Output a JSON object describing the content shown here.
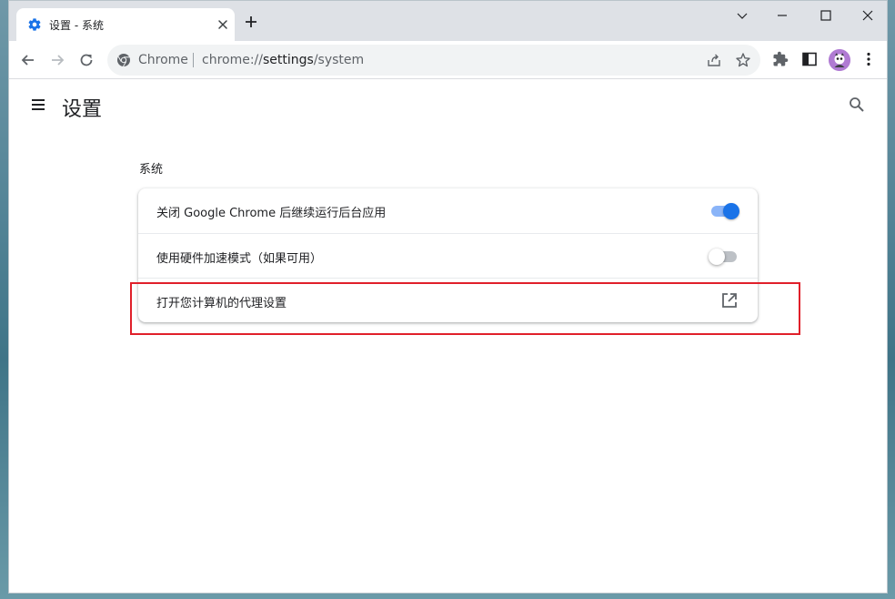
{
  "tab": {
    "title": "设置 - 系统",
    "icon": "gear-icon",
    "close_icon": "close-icon"
  },
  "new_tab_icon": "plus-icon",
  "window_controls": [
    "chevron-down-icon",
    "minimize-icon",
    "maximize-icon",
    "close-icon"
  ],
  "toolbar": {
    "back_icon": "back-arrow-icon",
    "forward_icon": "forward-arrow-icon",
    "reload_icon": "reload-icon",
    "omnibox": {
      "chip_label": "Chrome",
      "url_scheme": "chrome://",
      "url_host": "settings",
      "url_path": "/system",
      "share_icon": "share-icon",
      "bookmark_icon": "star-icon"
    },
    "extensions_icon": "puzzle-icon",
    "side_panel_icon": "side-panel-icon",
    "profile_icon": "avatar",
    "menu_icon": "kebab-menu-icon"
  },
  "settings": {
    "title": "设置",
    "section_title": "系统",
    "rows": [
      {
        "label": "关闭 Google Chrome 后继续运行后台应用",
        "control": "toggle",
        "checked": true
      },
      {
        "label": "使用硬件加速模式（如果可用）",
        "control": "toggle",
        "checked": false
      },
      {
        "label": "打开您计算机的代理设置",
        "control": "external-link",
        "icon": "open-in-new-icon"
      }
    ]
  },
  "colors": {
    "accent": "#1a73e8",
    "toggle_track_on": "#8ab4f8",
    "highlight_box": "#e0202a",
    "titlebar": "#dee1e6"
  }
}
